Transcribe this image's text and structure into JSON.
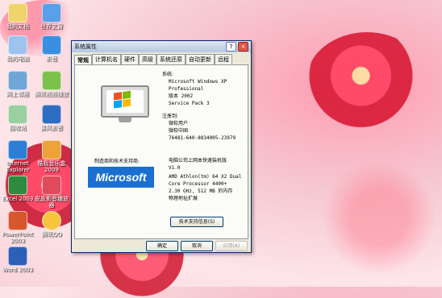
{
  "desktop": {
    "icons": [
      {
        "label": "我的文档",
        "icon": "my-documents-icon"
      },
      {
        "label": "世界之窗",
        "icon": "browser-icon"
      },
      {
        "label": "我的电脑",
        "icon": "my-computer-icon"
      },
      {
        "label": "影音",
        "icon": "media-icon"
      },
      {
        "label": "网上邻居",
        "icon": "network-icon"
      },
      {
        "label": "腾讯视频播放",
        "icon": "video-player-icon"
      },
      {
        "label": "回收站",
        "icon": "recycle-bin-icon"
      },
      {
        "label": "暴风影音",
        "icon": "storm-player-icon"
      },
      {
        "label": "Internet Explorer",
        "icon": "internet-explorer-icon"
      },
      {
        "label": "酷我音乐盒 2009",
        "icon": "music-box-icon"
      },
      {
        "label": "Excel 2003",
        "icon": "excel-icon"
      },
      {
        "label": "皮皮影音播放器",
        "icon": "player-icon"
      },
      {
        "label": "PowerPoint 2003",
        "icon": "powerpoint-icon"
      },
      {
        "label": "腾讯QQ",
        "icon": "qq-icon"
      },
      {
        "label": "Word 2003",
        "icon": "word-icon"
      }
    ]
  },
  "window": {
    "title": "系统属性",
    "help_btn": "?",
    "close_btn": "×",
    "tabs": [
      "常规",
      "计算机名",
      "硬件",
      "高级",
      "系统还原",
      "自动更新",
      "远程"
    ],
    "system": {
      "heading": "系统:",
      "lines": [
        "Microsoft Windows XP",
        "Professional",
        "版本 2002",
        "Service Pack 3"
      ]
    },
    "registered": {
      "heading": "注册到:",
      "lines": [
        "微软用户",
        "微软中国",
        "76481-640-8834005-23979"
      ]
    },
    "manufacturer": {
      "heading": "制造商和技术支持商:",
      "lines": [
        "电脑公司上网本快速装机版",
        "V1.0",
        "AMD Athlon(tm) 64 X2 Dual",
        "Core Processor 4400+",
        "2.30 GHz, 512 MB 的内存",
        "物理地址扩展"
      ]
    },
    "ms_logo": "Microsoft",
    "support_btn": "技术支持信息(S)",
    "ok_btn": "确定",
    "cancel_btn": "取消",
    "apply_btn": "应用(A)"
  }
}
